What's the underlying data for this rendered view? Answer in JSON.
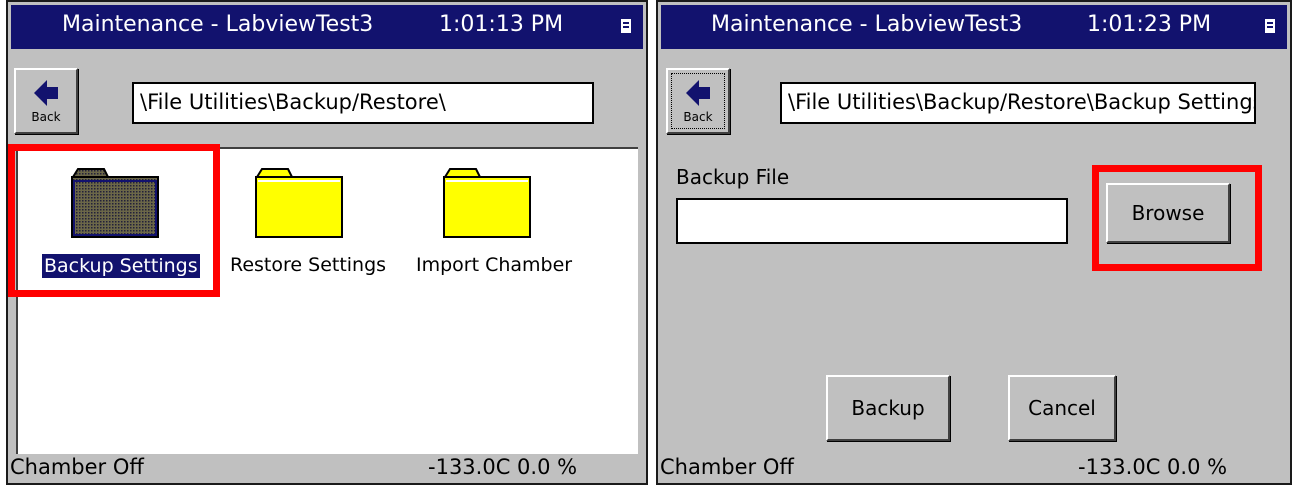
{
  "left": {
    "titlebar": {
      "app": "Maintenance - LabviewTest3",
      "time": "1:01:13 PM"
    },
    "back_label": "Back",
    "path": "\\File Utilities\\Backup/Restore\\",
    "folders": [
      {
        "label": "Backup Settings",
        "selected": true,
        "color": "#57543a"
      },
      {
        "label": "Restore Settings",
        "selected": false,
        "color": "#ffff00"
      },
      {
        "label": "Import Chamber",
        "selected": false,
        "color": "#ffff00"
      }
    ],
    "status": {
      "state": "Chamber Off",
      "reading": "-133.0C  0.0 %"
    }
  },
  "right": {
    "titlebar": {
      "app": "Maintenance - LabviewTest3",
      "time": "1:01:23 PM"
    },
    "back_label": "Back",
    "path": "\\File Utilities\\Backup/Restore\\Backup Settings\\",
    "backup_file_label": "Backup File",
    "backup_file_value": "",
    "browse_label": "Browse",
    "backup_label": "Backup",
    "cancel_label": "Cancel",
    "status": {
      "state": "Chamber Off",
      "reading": "-133.0C  0.0 %"
    }
  },
  "colors": {
    "titlebar": "#12126e",
    "highlight": "#ff0000",
    "panel": "#c0c0c0"
  }
}
